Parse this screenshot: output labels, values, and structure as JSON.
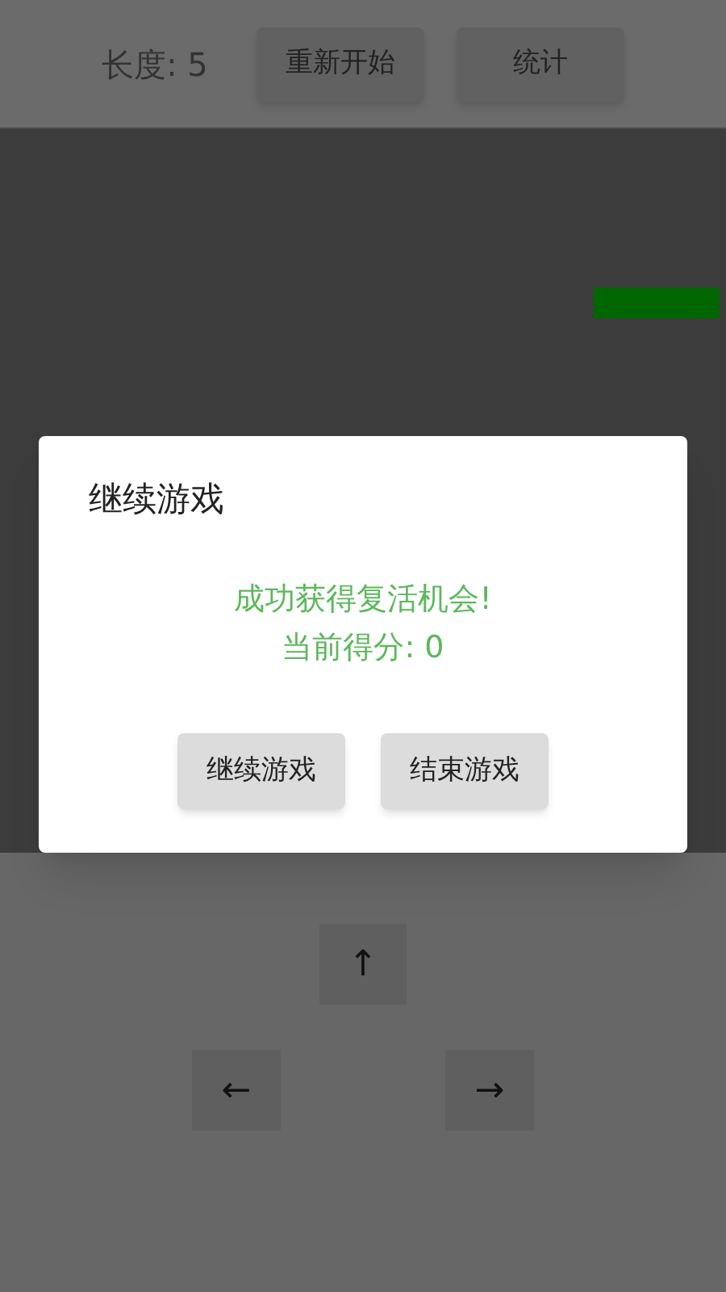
{
  "header": {
    "length_label": "长度: 5",
    "buttons": [
      "重新开始",
      "统计"
    ]
  },
  "dialog": {
    "title": "继续游戏",
    "message": "成功获得复活机会!",
    "score": "当前得分: 0",
    "buttons": [
      "继续游戏",
      "结束游戏"
    ]
  },
  "controls": {
    "up": "↑",
    "left": "←",
    "right": "→"
  }
}
